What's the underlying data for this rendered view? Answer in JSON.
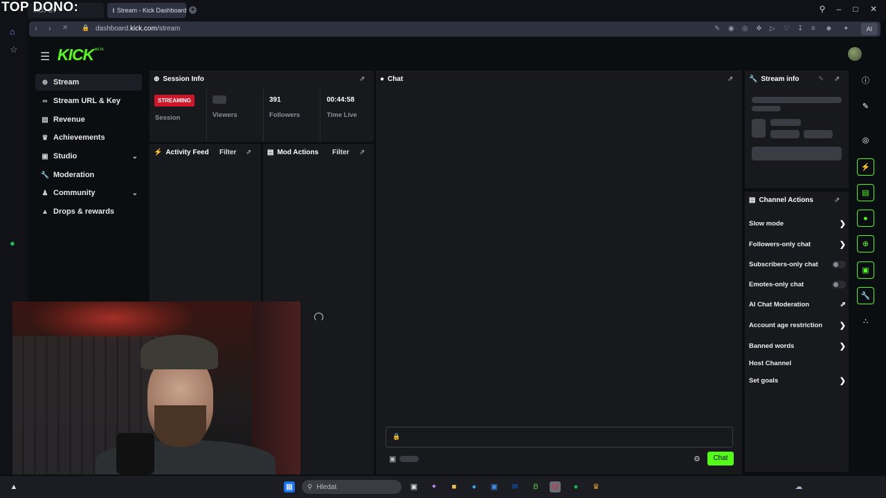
{
  "overlay": {
    "text": "TOP DONO:"
  },
  "browser": {
    "tabs": [
      {
        "label": "MUJ GV"
      },
      {
        "label": "Stream - Kick Dashboard"
      }
    ],
    "url_prefix": "dashboard.",
    "url_domain": "kick.com",
    "url_path": "/stream",
    "ai_label": "AI"
  },
  "kick": {
    "logo": "KICK",
    "logo_sup": "BETA",
    "nav": [
      {
        "label": "Stream",
        "icon": "radio-icon"
      },
      {
        "label": "Stream URL & Key",
        "icon": "link-icon"
      },
      {
        "label": "Revenue",
        "icon": "chart-icon"
      },
      {
        "label": "Achievements",
        "icon": "trophy-icon"
      },
      {
        "label": "Studio",
        "icon": "studio-icon"
      },
      {
        "label": "Moderation",
        "icon": "wrench-icon"
      },
      {
        "label": "Community",
        "icon": "users-icon"
      },
      {
        "label": "Drops & rewards",
        "icon": "gift-icon"
      }
    ],
    "session": {
      "title": "Session Info",
      "badge": "STREAMING",
      "session_label": "Session",
      "viewers_label": "Viewers",
      "followers_value": "391",
      "followers_label": "Followers",
      "time_value": "00:44:58",
      "time_label": "Time Live"
    },
    "activity": {
      "title": "Activity Feed",
      "filter": "Filter"
    },
    "mod_actions": {
      "title": "Mod Actions",
      "filter": "Filter"
    },
    "chat": {
      "title": "Chat",
      "send": "Chat"
    },
    "stream_info": {
      "title": "Stream info"
    },
    "channel_actions": {
      "title": "Channel Actions",
      "items": [
        {
          "label": "Slow mode",
          "control": "chevron"
        },
        {
          "label": "Followers-only chat",
          "control": "chevron"
        },
        {
          "label": "Subscribers-only chat",
          "control": "toggle"
        },
        {
          "label": "Emotes-only chat",
          "control": "toggle"
        },
        {
          "label": "AI Chat Moderation",
          "control": "external"
        },
        {
          "label": "Account age restriction",
          "control": "chevron"
        },
        {
          "label": "Banned words",
          "control": "chevron"
        },
        {
          "label": "Host Channel",
          "control": "none"
        },
        {
          "label": "Set goals",
          "control": "chevron"
        }
      ]
    }
  },
  "taskbar": {
    "search_placeholder": "Hledat"
  },
  "colors": {
    "kick_green": "#53fc18",
    "streaming_red": "#d0172a",
    "panel_bg": "#18191c"
  }
}
